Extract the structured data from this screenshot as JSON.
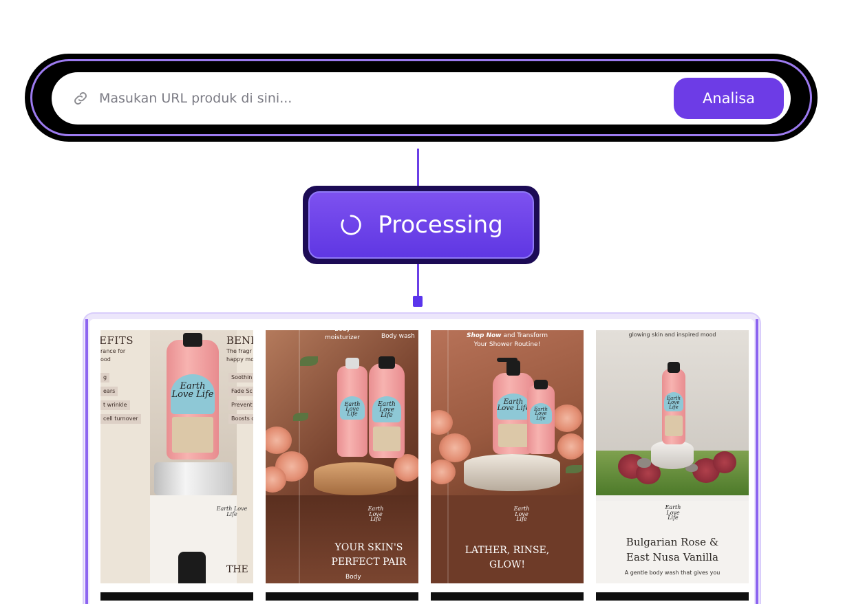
{
  "url_bar": {
    "placeholder": "Masukan URL produk di sini...",
    "analyze_label": "Analisa",
    "icon": "link-icon"
  },
  "processing": {
    "label": "Processing",
    "icon": "spinner-icon"
  },
  "gallery": {
    "cards": [
      {
        "heading_left": "EFITS",
        "heading_right": "BENE",
        "text_left": [
          "rance for",
          "ood"
        ],
        "text_right": [
          "The fragr",
          "happy mo"
        ],
        "chips_left": [
          "g",
          "ears",
          "t wrinkle",
          "cell turnover"
        ],
        "chips_right": [
          "Soothin",
          "Fade Sc",
          "Prevent",
          "Boosts c"
        ],
        "bottom_text": "THE",
        "brand": "Earth Love Life"
      },
      {
        "caption_left": "Body\nmoisturizer",
        "caption_right": "Body wash",
        "tagline": "YOUR SKIN'S\nPERFECT PAIR",
        "footer": "Body",
        "brand": "Earth Love Life"
      },
      {
        "headline_em": "Shop Now",
        "headline_rest": " and Transform",
        "headline_line2": "Your Shower Routine!",
        "tagline": "LATHER, RINSE,\nGLOW!",
        "brand": "Earth Love Life"
      },
      {
        "top_text": "glowing skin and inspired mood",
        "title_line1": "Bulgarian Rose &",
        "title_line2": "East Nusa Vanilla",
        "description": "A gentle body wash that gives you",
        "brand": "Earth Love Life"
      }
    ]
  },
  "colors": {
    "accent": "#6d3ce6",
    "processing_gradient_top": "#7d51ef",
    "connector": "#6a3fe6"
  }
}
